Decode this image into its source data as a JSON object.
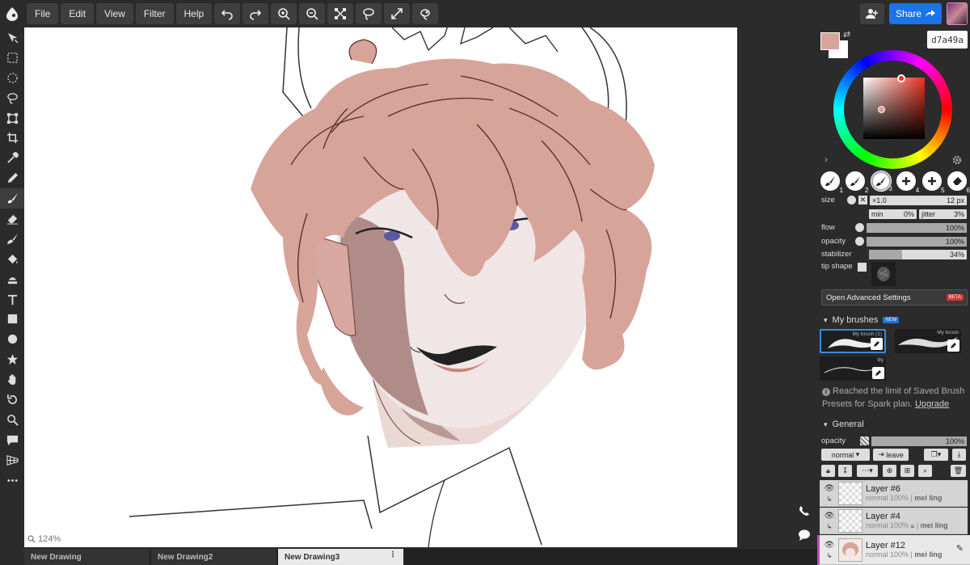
{
  "menu": [
    "File",
    "Edit",
    "View",
    "Filter",
    "Help"
  ],
  "toolbar_icons": [
    "undo-icon",
    "redo-icon",
    "zoom-in-icon",
    "zoom-out-icon",
    "transform-icon",
    "lasso-icon",
    "fullscreen-icon",
    "settings-icon"
  ],
  "share": {
    "label": "Share"
  },
  "color": {
    "hex": "d7a49a",
    "foreground": "#d7a49a",
    "background": "#ffffff"
  },
  "brush_presets": [
    "1",
    "2",
    "3",
    "4",
    "5",
    "6"
  ],
  "brush": {
    "size_label": "size",
    "size_mult": "×1.0",
    "size_value": "12 px",
    "min_label": "min",
    "min_value": "0%",
    "jitter_label": "jitter",
    "jitter_value": "3%",
    "flow_label": "flow",
    "flow_value": "100%",
    "flow_level": 1.0,
    "opacity_label": "opacity",
    "opacity_value": "100%",
    "opacity_level": 1.0,
    "stabilizer_label": "stabilizer",
    "stabilizer_value": "34%",
    "stabilizer_level": 0.34,
    "tip_label": "tip shape"
  },
  "advanced": {
    "label": "Open Advanced Settings",
    "badge": "BETA"
  },
  "my_brushes": {
    "title": "My brushes",
    "badge": "NEW",
    "items": [
      "My brush (1)",
      "My brush",
      "lily"
    ],
    "limit_text": "Reached the limit of Saved Brush Presets for Spark plan.",
    "upgrade": "Upgrade"
  },
  "general": {
    "title": "General",
    "opacity_label": "opacity",
    "opacity_value": "100%",
    "blend": "normal",
    "leave": "leave"
  },
  "layers": [
    {
      "name": "Layer #6",
      "meta": "normal 100%",
      "owner": "mei ling"
    },
    {
      "name": "Layer #4",
      "meta": "normal 100%",
      "owner": "mei ling"
    },
    {
      "name": "Layer #12",
      "meta": "normal 100%",
      "owner": "mei ling"
    }
  ],
  "canvas": {
    "zoom": "124%"
  },
  "tabs": [
    "New Drawing",
    "New Drawing2",
    "New Drawing3"
  ]
}
